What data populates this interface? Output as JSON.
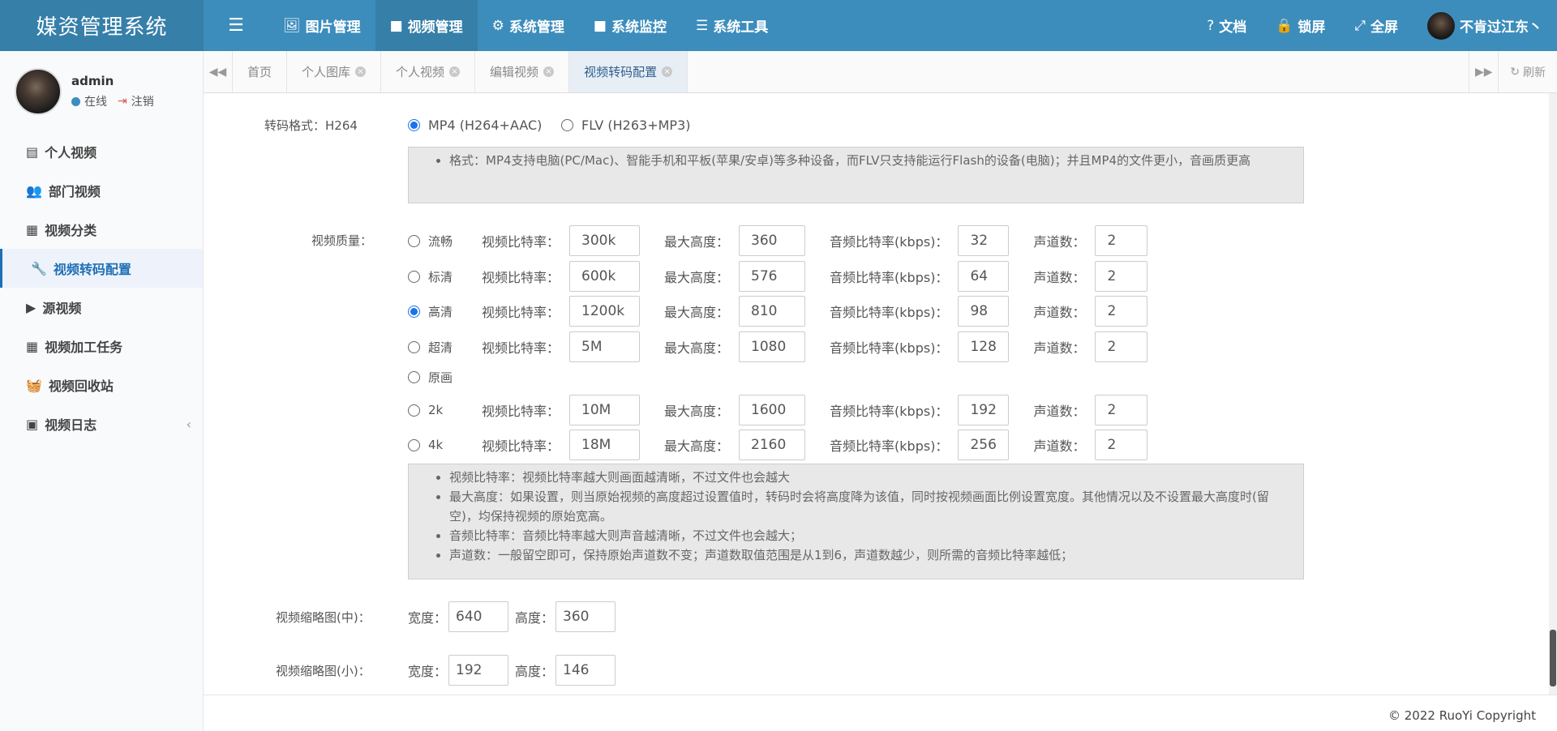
{
  "header": {
    "brand": "媒资管理系统",
    "nav": [
      {
        "icon": "image-icon",
        "label": "图片管理"
      },
      {
        "icon": "video-icon",
        "label": "视频管理"
      },
      {
        "icon": "gear-icon",
        "label": "系统管理"
      },
      {
        "icon": "video-icon",
        "label": "系统监控"
      },
      {
        "icon": "list-icon",
        "label": "系统工具"
      }
    ],
    "right": {
      "docs": "文档",
      "lock": "锁屏",
      "fullscreen": "全屏",
      "username": "不肯过江东丶"
    }
  },
  "sidebar": {
    "user": {
      "name": "admin",
      "status": "在线",
      "logout": "注销"
    },
    "items": [
      {
        "label": "个人视频",
        "icon": "file-icon"
      },
      {
        "label": "部门视频",
        "icon": "users-icon"
      },
      {
        "label": "视频分类",
        "icon": "calendar-icon"
      },
      {
        "label": "视频转码配置",
        "icon": "wrench-icon"
      },
      {
        "label": "源视频",
        "icon": "play-square-icon"
      },
      {
        "label": "视频加工任务",
        "icon": "calendar-icon"
      },
      {
        "label": "视频回收站",
        "icon": "basket-icon"
      },
      {
        "label": "视频日志",
        "icon": "calendar-minus-icon"
      }
    ],
    "collapse": "‹"
  },
  "tabs": {
    "items": [
      "首页",
      "个人图库",
      "个人视频",
      "编辑视频",
      "视频转码配置"
    ],
    "refresh": "刷新"
  },
  "form": {
    "format_label": "转码格式：H264",
    "format_options": [
      "MP4 (H264+AAC)",
      "FLV (H263+MP3)"
    ],
    "format_help": "格式：MP4支持电脑(PC/Mac)、智能手机和平板(苹果/安卓)等多种设备，而FLV只支持能运行Flash的设备(电脑)；并且MP4的文件更小，音画质更高",
    "quality_label": "视频质量：",
    "field_labels": {
      "vbit": "视频比特率：",
      "maxh": "最大高度：",
      "abit": "音频比特率(kbps)：",
      "ch": "声道数："
    },
    "qualities": [
      {
        "name": "流畅",
        "vbit": "300k",
        "maxh": "360",
        "abit": "32",
        "ch": "2"
      },
      {
        "name": "标清",
        "vbit": "600k",
        "maxh": "576",
        "abit": "64",
        "ch": "2"
      },
      {
        "name": "高清",
        "vbit": "1200k",
        "maxh": "810",
        "abit": "98",
        "ch": "2"
      },
      {
        "name": "超清",
        "vbit": "5M",
        "maxh": "1080",
        "abit": "128",
        "ch": "2"
      },
      {
        "name": "原画"
      },
      {
        "name": "2k",
        "vbit": "10M",
        "maxh": "1600",
        "abit": "192",
        "ch": "2"
      },
      {
        "name": "4k",
        "vbit": "18M",
        "maxh": "2160",
        "abit": "256",
        "ch": "2"
      }
    ],
    "quality_help": [
      "视频比特率：视频比特率越大则画面越清晰，不过文件也会越大",
      "最大高度：如果设置，则当原始视频的高度超过设置值时，转码时会将高度降为该值，同时按视频画面比例设置宽度。其他情况以及不设置最大高度时(留空)，均保持视频的原始宽高。",
      "音频比特率：音频比特率越大则声音越清晰，不过文件也会越大；",
      "声道数：一般留空即可，保持原始声道数不变；声道数取值范围是从1到6，声道数越少，则所需的音频比特率越低；"
    ],
    "thumb_mid": {
      "label": "视频缩略图(中)：",
      "width_label": "宽度：",
      "width": "640",
      "height_label": "高度：",
      "height": "360"
    },
    "thumb_small": {
      "label": "视频缩略图(小)：",
      "width_label": "宽度：",
      "width": "192",
      "height_label": "高度：",
      "height": "146"
    }
  },
  "footer": {
    "copyright": "© 2022 RuoYi Copyright"
  },
  "colors": {
    "topbar": "#3c8dbc",
    "brand_bg": "#367fa9",
    "accent": "#1a73e8"
  }
}
